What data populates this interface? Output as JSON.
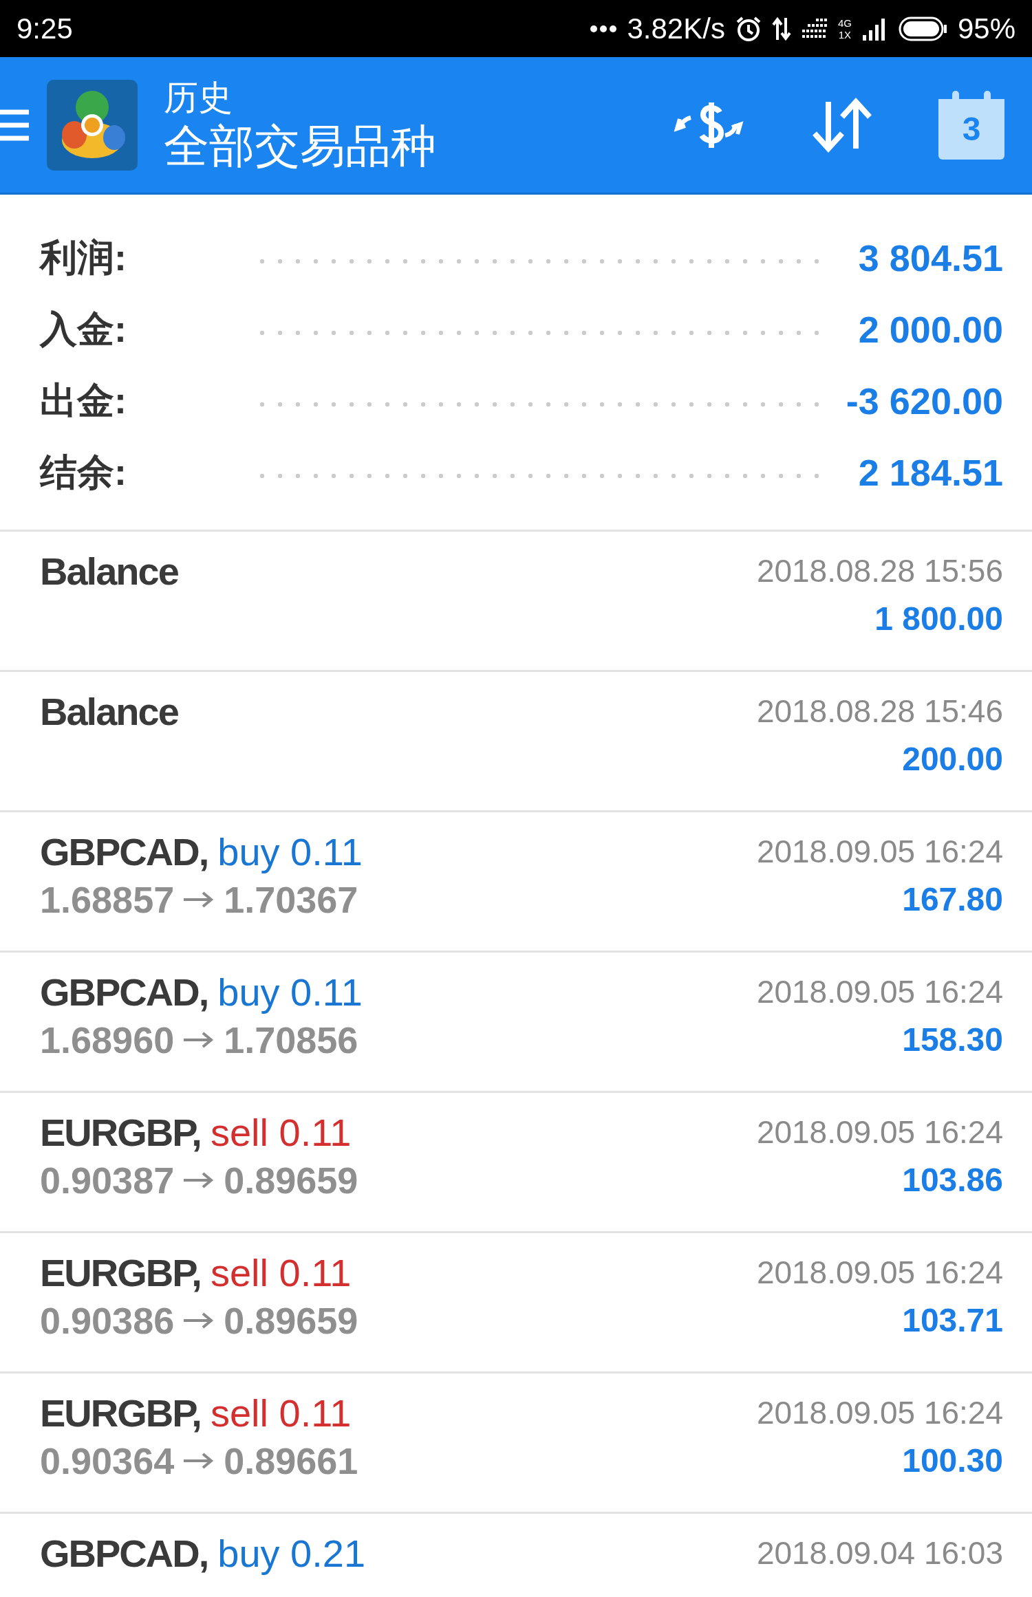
{
  "status_bar": {
    "time": "9:25",
    "speed": "3.82K/s",
    "network": "4G",
    "sim": "1X",
    "battery": "95%"
  },
  "header": {
    "title": "历史",
    "subtitle": "全部交易品种",
    "calendar_day": "3"
  },
  "summary": [
    {
      "label": "利润:",
      "value": "3 804.51"
    },
    {
      "label": "入金:",
      "value": "2 000.00"
    },
    {
      "label": "出金:",
      "value": "-3 620.00"
    },
    {
      "label": "结余:",
      "value": "2 184.51"
    }
  ],
  "deals": [
    {
      "kind": "balance",
      "symbol": "Balance",
      "time": "2018.08.28 15:56",
      "profit": "1 800.00"
    },
    {
      "kind": "balance",
      "symbol": "Balance",
      "time": "2018.08.28 15:46",
      "profit": "200.00"
    },
    {
      "kind": "trade",
      "symbol": "GBPCAD,",
      "side": "buy 0.11",
      "color": "#1976d2",
      "open_price": "1.68857",
      "close_price": "1.70367",
      "time": "2018.09.05 16:24",
      "profit": "167.80"
    },
    {
      "kind": "trade",
      "symbol": "GBPCAD,",
      "side": "buy 0.11",
      "color": "#1976d2",
      "open_price": "1.68960",
      "close_price": "1.70856",
      "time": "2018.09.05 16:24",
      "profit": "158.30"
    },
    {
      "kind": "trade",
      "symbol": "EURGBP,",
      "side": "sell 0.11",
      "color": "#d32f2f",
      "open_price": "0.90387",
      "close_price": "0.89659",
      "time": "2018.09.05 16:24",
      "profit": "103.86"
    },
    {
      "kind": "trade",
      "symbol": "EURGBP,",
      "side": "sell 0.11",
      "color": "#d32f2f",
      "open_price": "0.90386",
      "close_price": "0.89659",
      "time": "2018.09.05 16:24",
      "profit": "103.71"
    },
    {
      "kind": "trade",
      "symbol": "EURGBP,",
      "side": "sell 0.11",
      "color": "#d32f2f",
      "open_price": "0.90364",
      "close_price": "0.89661",
      "time": "2018.09.05 16:24",
      "profit": "100.30"
    },
    {
      "kind": "trade",
      "symbol": "GBPCAD,",
      "side": "buy 0.21",
      "color": "#1976d2",
      "time": "2018.09.04 16:03"
    }
  ]
}
